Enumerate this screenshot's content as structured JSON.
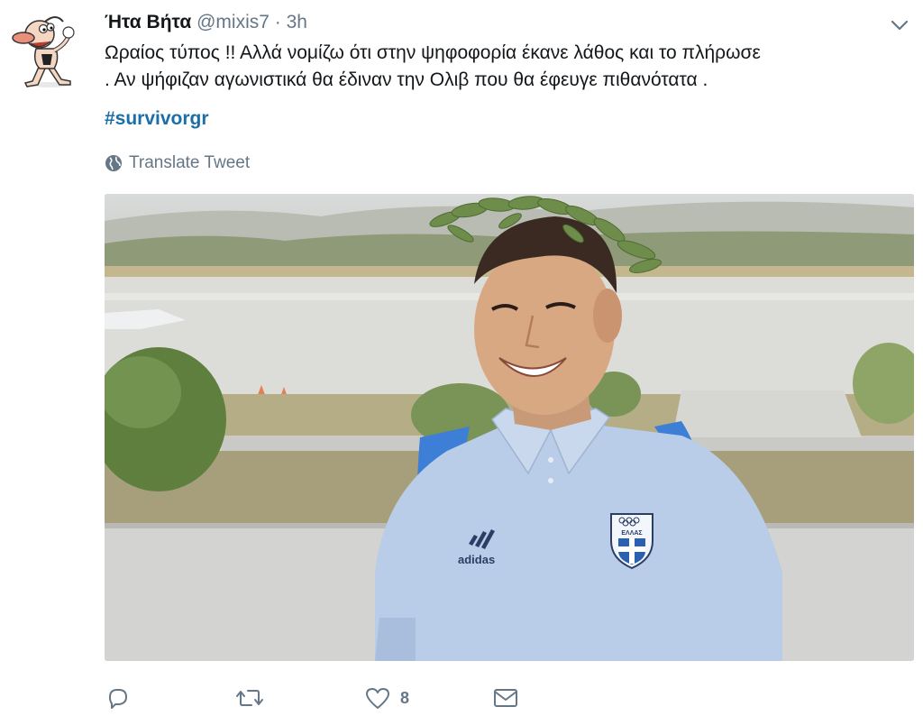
{
  "user": {
    "display_name": "Ήτα Βήτα",
    "handle": "@mixis7",
    "separator": "·",
    "time": "3h"
  },
  "tweet": {
    "line1": "Ωραίος τύπος !! Αλλά νομίζω ότι στην ψηφοφορία έκανε λάθος και το πλήρωσε",
    "line2": ". Αν ψήφιζαν αγωνιστικά θα έδιναν την Ολιβ που θα έφευγε πιθανότατα .",
    "hashtag": "#survivorgr"
  },
  "translate_label": "Translate Tweet",
  "media": {
    "shirt_brand": "adidas",
    "crest_text": "ΕΛΛΑΣ"
  },
  "actions": {
    "reply_icon": "reply-icon",
    "retweet_icon": "retweet-icon",
    "like_icon": "heart-icon",
    "like_count": "8",
    "dm_icon": "envelope-icon"
  },
  "colors": {
    "hashtag": "#1b6fa8",
    "muted": "#657786",
    "text": "#14171a"
  }
}
